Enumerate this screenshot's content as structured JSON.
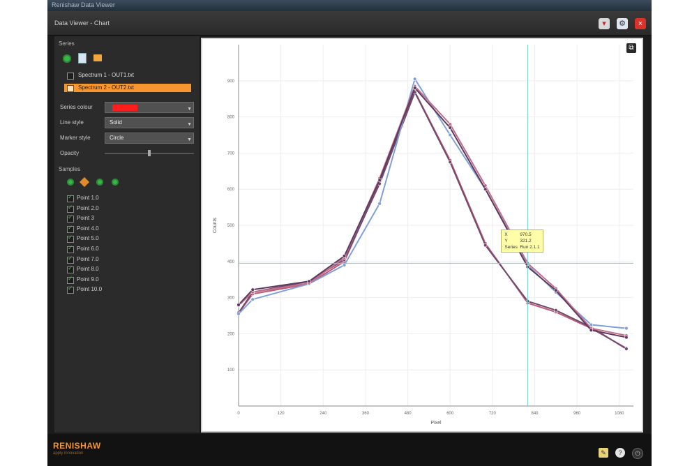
{
  "os_window": {
    "title": "Renishaw Data Viewer"
  },
  "window": {
    "title": "Data Viewer - Chart"
  },
  "sidebar": {
    "section_title": "Series",
    "toolbar_icons": [
      "add-icon",
      "document-icon",
      "folder-open-icon"
    ],
    "series_list": [
      {
        "label": "Spectrum 1 - OUT1.txt",
        "selected": false
      },
      {
        "label": "Spectrum 2 - OUT2.txt",
        "selected": true
      }
    ],
    "fields": {
      "color_label": "Series colour",
      "color_value": "#ff1c1c",
      "line_label": "Line style",
      "line_value": "Solid",
      "marker_label": "Marker style",
      "marker_value": "Circle",
      "opacity_label": "Opacity"
    },
    "samples_title": "Samples",
    "samples_toolbar_icons": [
      "add-icon",
      "edit-icon",
      "copy-icon",
      "remove-icon"
    ],
    "samples": [
      "Point 1.0",
      "Point 2.0",
      "Point 3",
      "Point 4.0",
      "Point 5.0",
      "Point 6.0",
      "Point 7.0",
      "Point 8.0",
      "Point 9.0",
      "Point 10.0"
    ]
  },
  "footer": {
    "logo": "RENISHAW",
    "logo_sub": "apply innovation",
    "buttons": [
      "notes-icon",
      "help-icon",
      "power-icon"
    ]
  },
  "tooltip": {
    "rows": [
      {
        "k": "X",
        "v": "970.5"
      },
      {
        "k": "Y",
        "v": "321.2"
      },
      {
        "k": "Series",
        "v": "Run 2.1.1"
      }
    ]
  },
  "colors": {
    "accent": "#f5962f",
    "selected_swatch": "#ff1c1c"
  },
  "chart_data": {
    "type": "line",
    "xlabel": "Pixel",
    "ylabel": "Counts",
    "xlim": [
      0,
      1120
    ],
    "ylim": [
      0,
      1000
    ],
    "x_ticks": [
      0,
      120,
      240,
      360,
      480,
      600,
      720,
      840,
      960,
      1080
    ],
    "y_ticks": [
      100,
      200,
      300,
      400,
      500,
      600,
      700,
      800,
      900
    ],
    "grid": true,
    "crosshair": {
      "x": 820,
      "y": 395
    },
    "series": [
      {
        "color": "#c05a78",
        "x": [
          0,
          40,
          200,
          300,
          400,
          500,
          600,
          700,
          820,
          900,
          1000,
          1100
        ],
        "y": [
          257,
          310,
          338,
          400,
          620,
          870,
          680,
          450,
          285,
          260,
          215,
          160
        ]
      },
      {
        "color": "#6e4a6e",
        "x": [
          0,
          40,
          200,
          300,
          400,
          500,
          600,
          700,
          820,
          900,
          1000,
          1100
        ],
        "y": [
          258,
          315,
          345,
          405,
          615,
          868,
          675,
          445,
          290,
          265,
          218,
          158
        ]
      },
      {
        "color": "#7fa0d8",
        "x": [
          0,
          40,
          200,
          300,
          400,
          500,
          600,
          700,
          820,
          900,
          1000,
          1100
        ],
        "y": [
          255,
          295,
          338,
          390,
          560,
          905,
          750,
          600,
          390,
          315,
          225,
          215
        ]
      },
      {
        "color": "#c0708a",
        "x": [
          0,
          40,
          200,
          300,
          400,
          500,
          600,
          700,
          820,
          900,
          1000,
          1100
        ],
        "y": [
          278,
          315,
          340,
          410,
          630,
          885,
          780,
          610,
          395,
          325,
          215,
          195
        ]
      },
      {
        "color": "#5e3a5e",
        "x": [
          0,
          40,
          200,
          300,
          400,
          500,
          600,
          700,
          820,
          900,
          1000,
          1100
        ],
        "y": [
          280,
          322,
          345,
          415,
          625,
          880,
          770,
          600,
          385,
          320,
          210,
          190
        ]
      }
    ]
  }
}
